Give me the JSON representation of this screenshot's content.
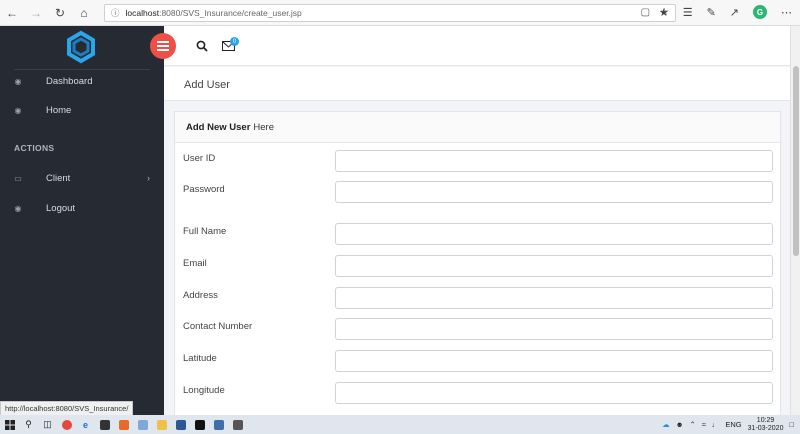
{
  "browser": {
    "url_host": "localhost",
    "url_path": ":8080/SVS_Insurance/create_user.jsp",
    "nav_icons": [
      "back-arrow-icon",
      "forward-arrow-icon",
      "refresh-icon",
      "home-icon"
    ],
    "profile_initial": "G"
  },
  "sidebar": {
    "items": [
      {
        "label": "Dashboard",
        "icon": "dashboard-icon"
      },
      {
        "label": "Home",
        "icon": "home-gauge-icon"
      }
    ],
    "section_title": "ACTIONS",
    "actions": [
      {
        "label": "Client",
        "icon": "laptop-icon",
        "chevron": "›"
      },
      {
        "label": "Logout",
        "icon": "logout-icon"
      }
    ]
  },
  "topbar": {
    "mail_badge": "0"
  },
  "page": {
    "title": "Add User"
  },
  "form": {
    "heading_bold": "Add New User",
    "heading_rest": "Here",
    "fields": [
      {
        "label": "User ID",
        "value": ""
      },
      {
        "label": "Password",
        "value": ""
      },
      {
        "label": "Full Name",
        "value": ""
      },
      {
        "label": "Email",
        "value": ""
      },
      {
        "label": "Address",
        "value": ""
      },
      {
        "label": "Contact Number",
        "value": ""
      },
      {
        "label": "Latitude",
        "value": ""
      },
      {
        "label": "Longitude",
        "value": ""
      }
    ]
  },
  "status_url": "http://localhost:8080/SVS_Insurance/",
  "taskbar": {
    "lang": "ENG",
    "time": "10:29",
    "date": "31-03-2020"
  },
  "colors": {
    "sidebar_bg": "#262a33",
    "accent_red": "#ee4f47",
    "badge_blue": "#29a3e5"
  }
}
